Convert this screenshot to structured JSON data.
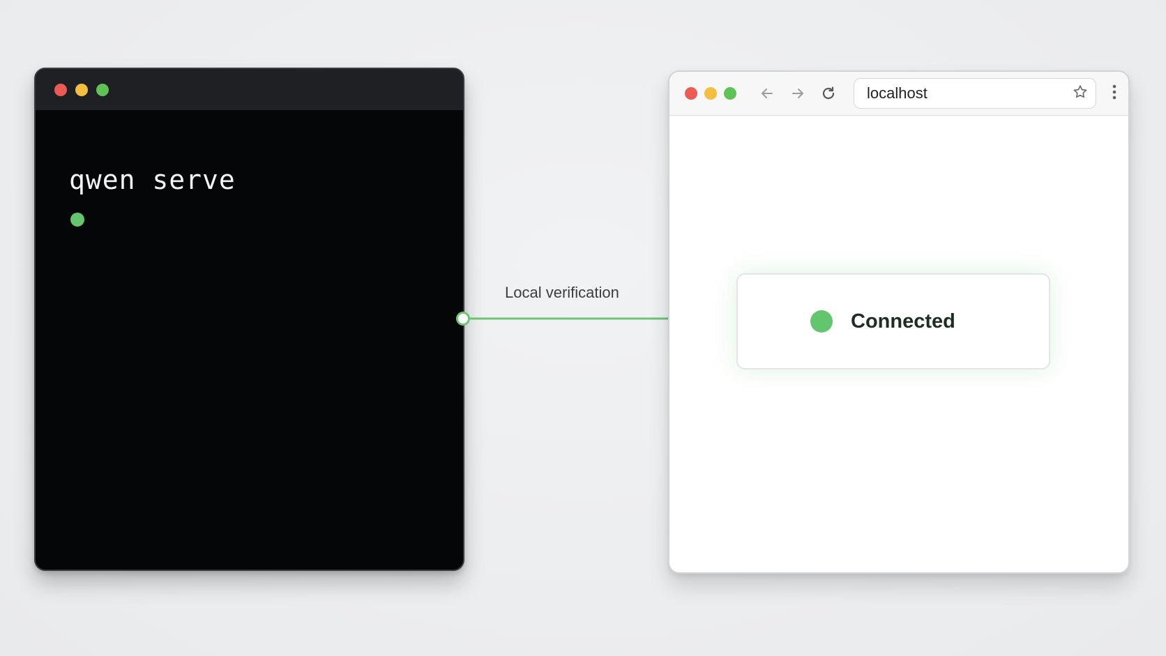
{
  "terminal": {
    "command": "qwen serve",
    "status_color": "#63c56e",
    "traffic_lights": [
      "#ec5b54",
      "#f4bf3f",
      "#5ec255"
    ]
  },
  "connector": {
    "label": "Local verification",
    "color": "#6cc477"
  },
  "browser": {
    "traffic_lights": [
      "#ec5b54",
      "#f4bf3f",
      "#5ec255"
    ],
    "address": "localhost",
    "nav_icons": [
      "back-arrow-icon",
      "forward-arrow-icon",
      "reload-icon"
    ],
    "status": {
      "text": "Connected",
      "color": "#63c56e"
    }
  }
}
